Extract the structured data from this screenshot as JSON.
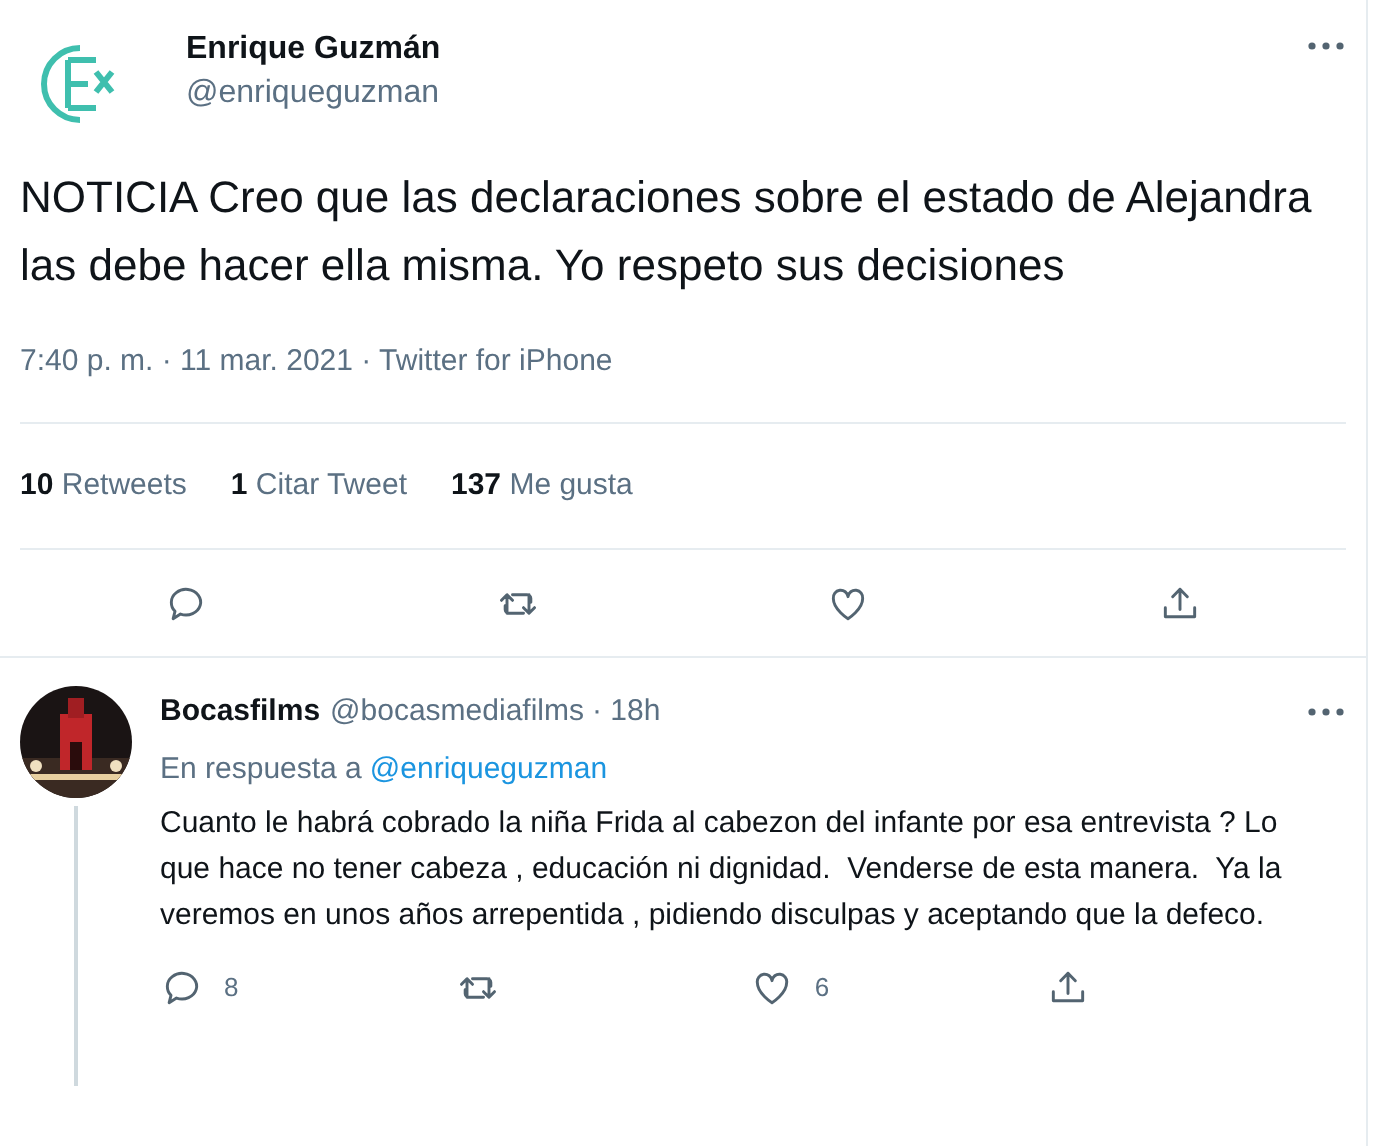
{
  "tweet": {
    "author": {
      "name": "Enrique Guzmán",
      "handle": "@enriqueguzman"
    },
    "text": "NOTICIA Creo que las declaraciones sobre el estado de Alejandra las debe hacer ella misma. Yo respeto sus decisiones",
    "meta": "7:40 p. m. · 11 mar. 2021 · Twitter for iPhone",
    "stats": [
      {
        "count": "10",
        "label": "Retweets"
      },
      {
        "count": "1",
        "label": "Citar Tweet"
      },
      {
        "count": "137",
        "label": "Me gusta"
      }
    ],
    "actions": [
      {
        "kind": "reply"
      },
      {
        "kind": "retweet"
      },
      {
        "kind": "like"
      },
      {
        "kind": "share"
      }
    ]
  },
  "reply": {
    "author": {
      "name": "Bocasfilms",
      "handle": "@bocasmediafilms",
      "time": "· 18h"
    },
    "replying_to": {
      "label": "En respuesta a",
      "mention": "@enriqueguzman"
    },
    "text": "Cuanto le habrá cobrado la niña Frida al cabezon del infante por esa entrevista ? Lo que hace no tener cabeza , educación ni dignidad.  Venderse de esta manera.  Ya la veremos en unos años arrepentida , pidiendo disculpas y aceptando que la defeco.",
    "actions": [
      {
        "kind": "reply",
        "count": "8"
      },
      {
        "kind": "retweet"
      },
      {
        "kind": "like",
        "count": "6"
      },
      {
        "kind": "share"
      }
    ]
  }
}
